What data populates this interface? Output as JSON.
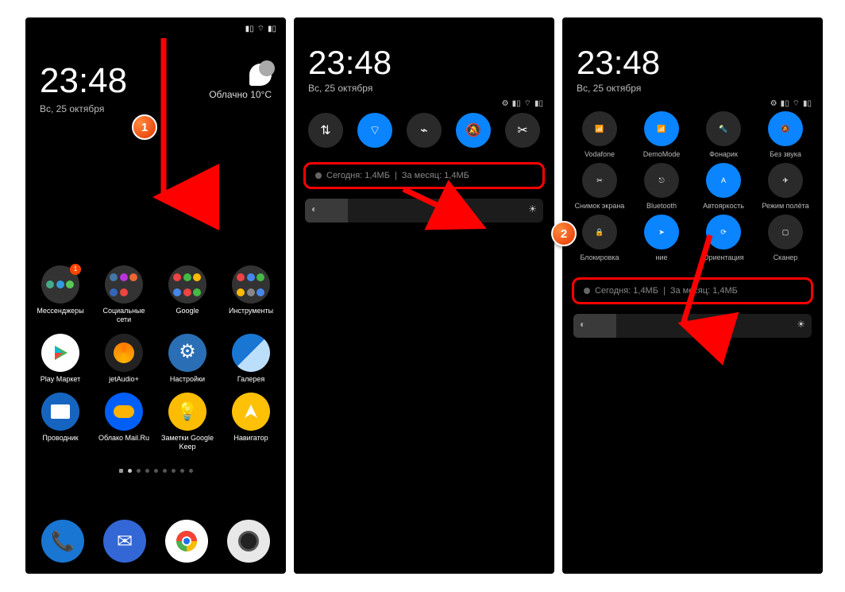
{
  "status": {
    "time": "23:48",
    "date": "Вс, 25 октября"
  },
  "weather": {
    "desc": "Облачно",
    "temp": "10°C"
  },
  "apps": {
    "row1": [
      "Мессенджеры",
      "Социальные сети",
      "Google",
      "Инструменты"
    ],
    "row2": [
      "Play Маркет",
      "jetAudio+",
      "Настройки",
      "Галерея"
    ],
    "row3": [
      "Проводник",
      "Облако Mail.Ru",
      "Заметки Google Keep",
      "Навигатор"
    ],
    "badge1": "1"
  },
  "qs_small": {
    "gear": "⚙"
  },
  "data_usage": {
    "today": "Сегодня: 1,4МБ",
    "sep": "|",
    "month": "За месяц: 1,4МБ"
  },
  "qs_expanded": [
    {
      "label": "Vodafone",
      "on": false,
      "glyph": "📶"
    },
    {
      "label": "DemoMode",
      "on": true,
      "glyph": "📶"
    },
    {
      "label": "Фонарик",
      "on": false,
      "glyph": "🔦"
    },
    {
      "label": "Без звука",
      "on": true,
      "glyph": "🔕"
    },
    {
      "label": "Снимок экрана",
      "on": false,
      "glyph": "✂"
    },
    {
      "label": "Bluetooth",
      "on": false,
      "glyph": "⎋"
    },
    {
      "label": "Автояркость",
      "on": true,
      "glyph": "A"
    },
    {
      "label": "Режим полёта",
      "on": false,
      "glyph": "✈"
    },
    {
      "label": "Блокировка",
      "on": false,
      "glyph": "🔒"
    },
    {
      "label": "ние",
      "on": true,
      "glyph": "➤"
    },
    {
      "label": "Ориентация",
      "on": true,
      "glyph": "⟳"
    },
    {
      "label": "Сканер",
      "on": false,
      "glyph": "▢"
    }
  ],
  "steps": {
    "s1": "1",
    "s2": "2"
  }
}
